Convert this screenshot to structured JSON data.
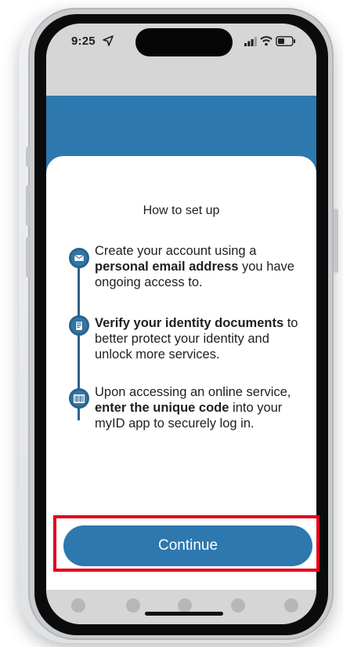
{
  "status_bar": {
    "time": "9:25",
    "icons": [
      "location-arrow-icon",
      "cellular-signal-icon",
      "wifi-icon",
      "battery-icon"
    ]
  },
  "onboarding": {
    "title": "How to set up",
    "steps": [
      {
        "icon": "envelope-icon",
        "segments": [
          {
            "text": "Create your account using a ",
            "bold": false
          },
          {
            "text": "personal email address",
            "bold": true
          },
          {
            "text": " you have ongoing access to.",
            "bold": false
          }
        ]
      },
      {
        "icon": "id-document-icon",
        "segments": [
          {
            "text": "Verify your identity documents",
            "bold": true
          },
          {
            "text": " to better protect your identity and unlock more services.",
            "bold": false
          }
        ]
      },
      {
        "icon": "barcode-code-icon",
        "segments": [
          {
            "text": "Upon accessing an online service, ",
            "bold": false
          },
          {
            "text": "enter the unique code",
            "bold": true
          },
          {
            "text": " into your myID app to securely log in.",
            "bold": false
          }
        ]
      }
    ],
    "continue_label": "Continue"
  },
  "tab_bar": {
    "items": [
      "tab-item",
      "tab-item",
      "tab-item",
      "tab-item",
      "tab-item"
    ]
  },
  "colors": {
    "accent": "#2d78ae",
    "highlight": "#e3001b",
    "card": "#ffffff",
    "chrome": "#d6d6d6"
  }
}
